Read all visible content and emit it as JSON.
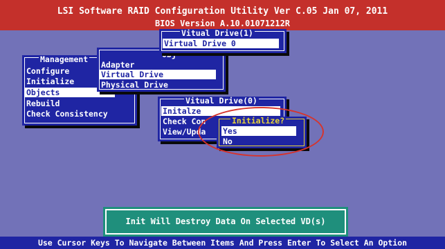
{
  "header": {
    "title": "LSI Software RAID Configuration Utility Ver C.05 Jan 07, 2011",
    "bios_version": "BIOS Version   A.10.01071212R"
  },
  "management_menu": {
    "title": "Management",
    "items": [
      "Configure",
      "Initialize",
      "Objects",
      "Rebuild",
      "Check Consistency"
    ],
    "selected_index": 2
  },
  "objects_menu": {
    "title": "Obj",
    "items": [
      "Adapter",
      "Virtual Drive",
      "Physical Drive"
    ],
    "selected_index": 1
  },
  "virtual_drive_list": {
    "title": "Vitual Drive(1)",
    "items": [
      "Virtual Drive 0"
    ],
    "selected_index": 0
  },
  "virtual_drive_menu": {
    "title": "Vitual Drive(0)",
    "items": [
      "Initalze",
      "Check Con",
      "View/Upda"
    ],
    "selected_index": 0
  },
  "initialize_dialog": {
    "title": "Initialize?",
    "options": [
      "Yes",
      "No"
    ],
    "selected_index": 0
  },
  "message": "Init Will Destroy Data On Selected VD(s)",
  "footer": "Use Cursor Keys To Navigate Between Items And Press Enter To Select An Option",
  "colors": {
    "background": "#7272b8",
    "header": "#c4302b",
    "panel": "#1f25a3",
    "message_panel": "#1f8f7c",
    "dialog_border": "#e8d43a",
    "highlight_oval": "#d6342c"
  }
}
